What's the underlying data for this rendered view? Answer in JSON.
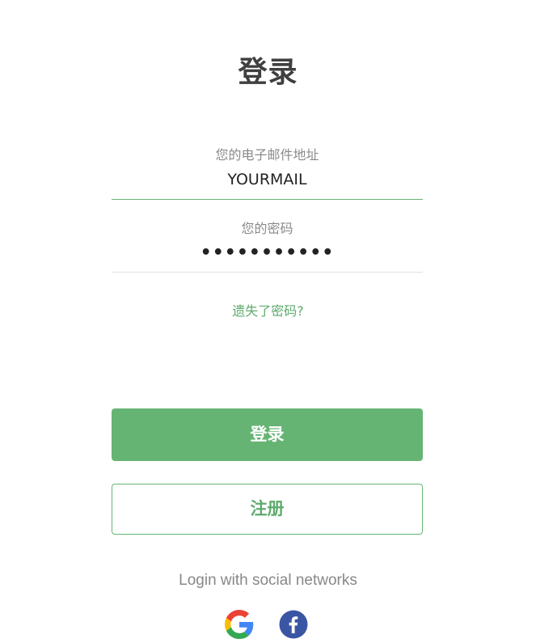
{
  "title": "登录",
  "email": {
    "label": "您的电子邮件地址",
    "value": "YOURMAIL"
  },
  "password": {
    "label": "您的密码",
    "value": "•••••••••••"
  },
  "forgot_link": "遗失了密码?",
  "buttons": {
    "login": "登录",
    "register": "注册"
  },
  "social": {
    "text": "Login with social networks",
    "icons": [
      "google-icon",
      "facebook-icon"
    ]
  },
  "colors": {
    "accent": "#66b474",
    "link": "#5eaa6d",
    "facebook": "#3b55a5"
  }
}
